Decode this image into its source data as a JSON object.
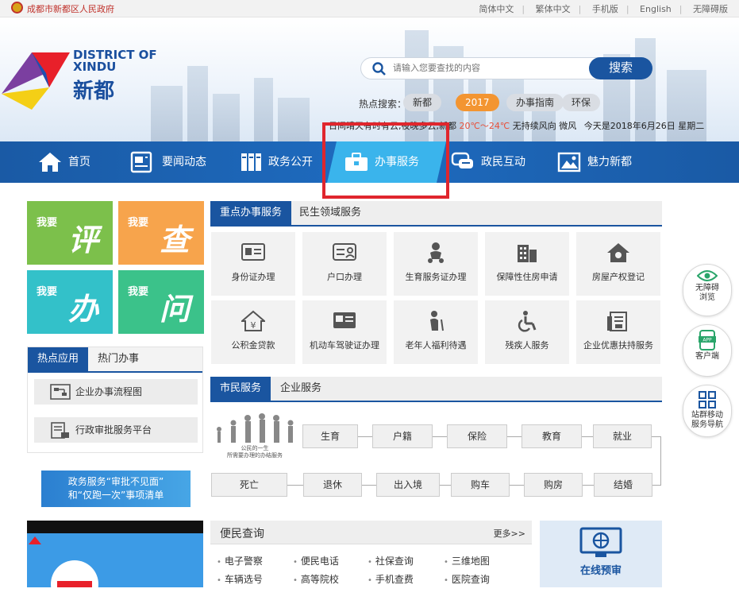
{
  "topbar": {
    "gov_name": "成都市新都区人民政府",
    "links": [
      "简体中文",
      "繁体中文",
      "手机版",
      "English",
      "无障碍版"
    ]
  },
  "logo": {
    "en": "DISTRICT OF XINDU",
    "cn": "新都"
  },
  "search": {
    "placeholder": "请输入您要查找的内容",
    "button": "搜索"
  },
  "hot_search": {
    "label": "热点搜索：",
    "tags": [
      "新都",
      "2017",
      "办事指南",
      "环保"
    ]
  },
  "weather": {
    "prefix": "日间晴天有时有云,夜晚多云,新都",
    "temp": "20℃～24℃",
    "wind": "无持续风向 微风",
    "date": "今天是2018年6月26日 星期二"
  },
  "nav": {
    "items": [
      "首页",
      "要闻动态",
      "政务公开",
      "办事服务",
      "政民互动",
      "魅力新都"
    ],
    "active_index": 3
  },
  "quick": [
    {
      "small": "我要",
      "big": "评",
      "color": "#7cc04b"
    },
    {
      "small": "我要",
      "big": "查",
      "color": "#f7a44c"
    },
    {
      "small": "我要",
      "big": "办",
      "color": "#33c1c9"
    },
    {
      "small": "我要",
      "big": "问",
      "color": "#3bc28a"
    }
  ],
  "key_tabs": [
    "重点办事服务",
    "民生领域服务"
  ],
  "services": [
    "身份证办理",
    "户口办理",
    "生育服务证办理",
    "保障性住房申请",
    "房屋产权登记",
    "公积金贷款",
    "机动车驾驶证办理",
    "老年人福利待遇",
    "残疾人服务",
    "企业优惠扶持服务"
  ],
  "apps": {
    "tabs": [
      "热点应用",
      "热门办事"
    ],
    "items": [
      "企业办事流程图",
      "行政审批服务平台"
    ]
  },
  "banner": {
    "line1": "政务服务“审批不见面”",
    "line2": "和“仅跑一次”事项清单"
  },
  "citizen_tabs": [
    "市民服务",
    "企业服务"
  ],
  "life_caption": {
    "line1": "公民的一生",
    "line2": "所需要办理的办结服务"
  },
  "life_steps_top": [
    "生育",
    "户籍",
    "保险",
    "教育",
    "就业"
  ],
  "life_steps_bottom": [
    "死亡",
    "退休",
    "出入境",
    "购车",
    "购房",
    "结婚"
  ],
  "side": [
    {
      "lines": [
        "无障碍",
        "浏览"
      ]
    },
    {
      "lines": [
        "客户端"
      ],
      "badge": "APP"
    },
    {
      "lines": [
        "站群移动",
        "服务导航"
      ]
    }
  ],
  "query": {
    "title": "便民查询",
    "more": "更多>>",
    "items": [
      "电子警察",
      "便民电话",
      "社保查询",
      "三维地图",
      "车辆选号",
      "高等院校",
      "手机查费",
      "医院查询"
    ]
  },
  "online": {
    "label": "在线预审"
  },
  "colors": {
    "primary": "#1a55a0",
    "nav_active": "#3ab4ec",
    "highlight": "#e0262d",
    "hot_tag": "#f39531"
  }
}
